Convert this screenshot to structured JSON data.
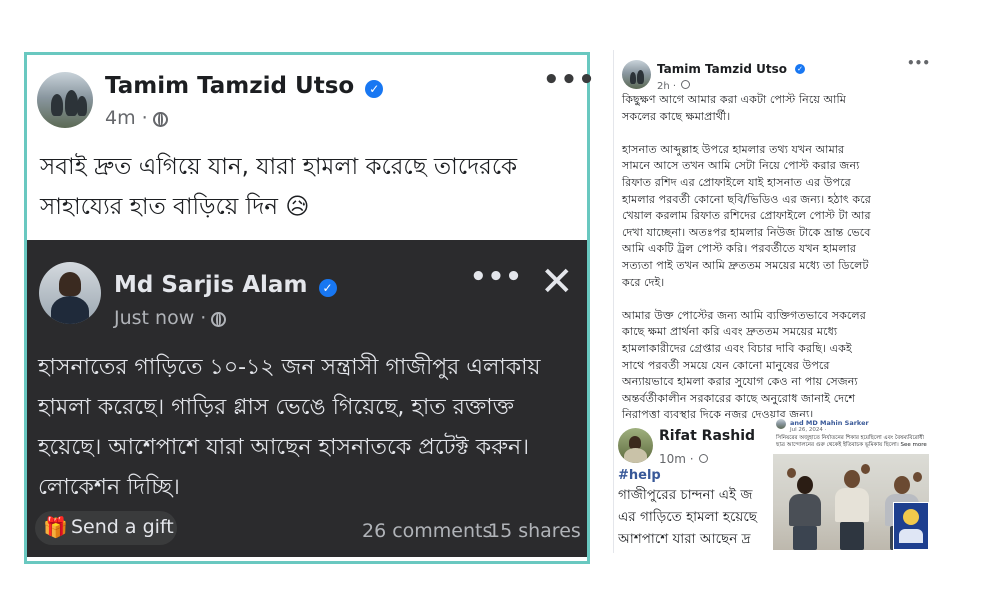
{
  "left_post": {
    "author": "Tamim Tamzid Utso",
    "time": "4m ·",
    "text_line1": "সবাই দ্রুত এগিয়ে যান, যারা হামলা করেছে তাদেরকে",
    "text_line2": "সাহায্যের হাত বাড়িয়ে দিন 😥"
  },
  "shared_post": {
    "author": "Md Sarjis Alam",
    "time": "Just now ·",
    "lines": [
      "হাসনাতের গাড়িতে ১০-১২ জন সন্ত্রাসী গাজীপুর এলাকায়",
      "হামলা করেছে। গাড়ির গ্লাস ভেঙে গিয়েছে, হাত রক্তাক্ত",
      "হয়েছে। আশেপাশে যারা আছেন হাসনাতকে প্রটেক্ট করুন।",
      "লোকেশন দিচ্ছি।"
    ],
    "send_gift": "Send a gift",
    "comments": "26 comments",
    "shares": "15 shares",
    "icons": [
      "more-icon",
      "close-icon",
      "gift-icon",
      "globe-icon",
      "verified-icon"
    ]
  },
  "right_post": {
    "author": "Tamim Tamzid Utso",
    "time": "2h ·",
    "body": "কিছুক্ষণ আগে আমার করা একটা পোস্ট নিয়ে আমি\nসকলের কাছে ক্ষমাপ্রার্থী।\n\nহাসনাত আব্দুল্লাহ উপরে হামলার তথ্য যখন আমার\nসামনে আসে তখন আমি সেটা নিয়ে পোস্ট করার জন্য\nরিফাত রশিদ এর প্রোফাইলে যাই হাসনাত এর উপরে\nহামলার পরবর্তী কোনো ছবি/ভিডিও এর জন্য। হঠাৎ করে\nখেয়াল করলাম রিফাত রশিদের প্রোফাইলে পোস্ট টা আর\nদেখা যাচ্ছেনা। অতঃপর হামলার নিউজ টাকে ভ্রান্ত ভেবে\nআমি একটি ট্রল পোস্ট করি। পরবর্তীতে যখন হামলার\nসত্যতা পাই তখন আমি দ্রুততম সময়ের মধ্যে তা ডিলেট\nকরে দেই।\n\nআমার উক্ত পোস্টের জন্য আমি ব্যক্তিগতভাবে সকলের\nকাছে ক্ষমা প্রার্থনা করি এবং দ্রুততম সময়ের মধ্যে\nহামলাকারীদের গ্রেপ্তার এবং বিচার দাবি করছি। একই\nসাথে পরবর্তী সময়ে যেন কোনো মানুষের উপরে\nঅন্যায়ভাবে হামলা করার সুযোগ কেও না পায় সেজন্য\nঅন্তর্বর্তীকালীন সরকারের কাছে অনুরোধ জানাই দেশে\nনিরাপত্তা ব্যবস্থার দিকে নজর দেওয়ার জন্য।"
  },
  "rifat_post": {
    "author": "Rifat Rashid",
    "time": "10m ·",
    "hashtag": "#help",
    "lines": [
      "গাজীপুরের চান্দনা এই জ",
      "এর গাড়িতে হামলা হয়েছে",
      "আশপাশে যারা আছেন দ্র"
    ]
  },
  "embedded_post": {
    "author": "and MD Mahin Sarker",
    "time": "Jul 26, 2024 · ",
    "text": "সিনিয়রের অজুহাতে নির্যাতনের শিকার হয়েছিলো এবং বৈষম্যবিরোধী ছাত্র আন্দোলনের গুরু থেকেই ইতিবাচক ভূমিকায় ছিলো। See more"
  }
}
